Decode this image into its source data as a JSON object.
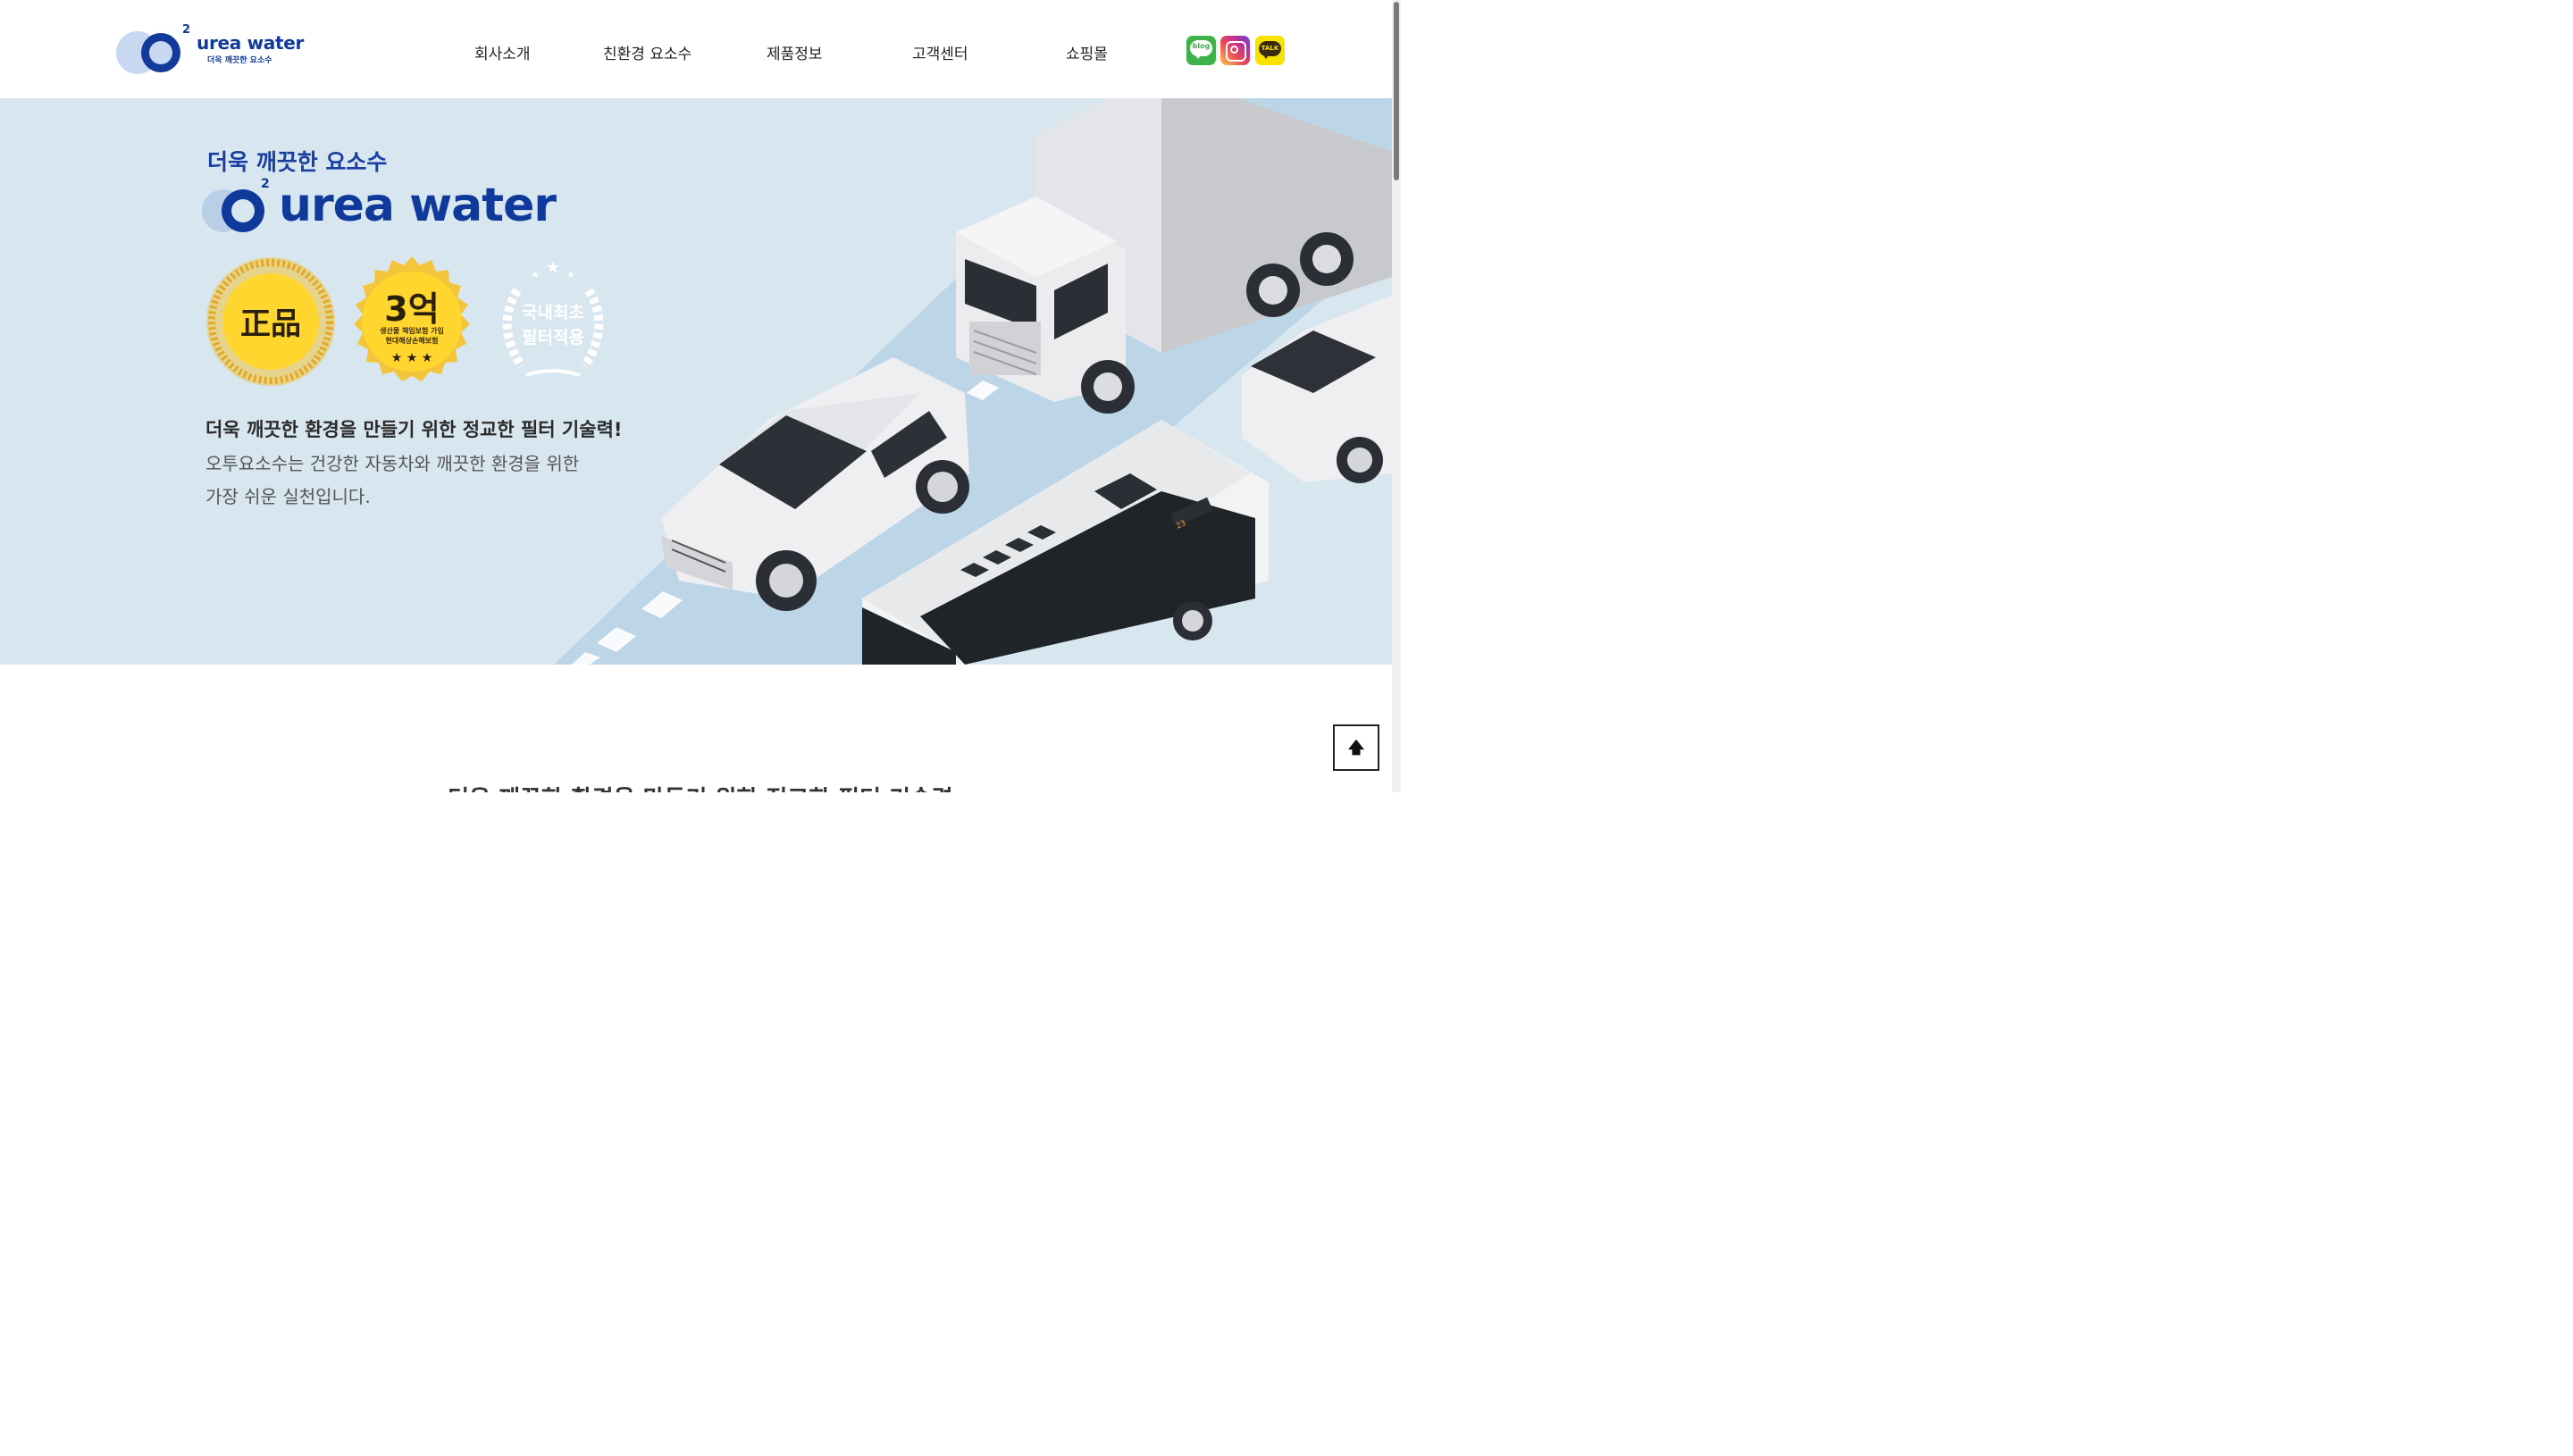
{
  "header": {
    "logo": {
      "sup": "2",
      "name": "urea water",
      "tagline": "더욱 깨끗한 요소수"
    },
    "nav": [
      {
        "label": "회사소개"
      },
      {
        "label": "친환경 요소수"
      },
      {
        "label": "제품정보"
      },
      {
        "label": "고객센터"
      },
      {
        "label": "쇼핑몰"
      }
    ],
    "social": [
      {
        "name": "blog",
        "label": "blog",
        "color": "#3fb24a"
      },
      {
        "name": "instagram",
        "label": "",
        "color": "#e9435b"
      },
      {
        "name": "kakaotalk",
        "label": "TALK",
        "color": "#f7e200"
      }
    ]
  },
  "hero": {
    "tagline": "더욱 깨끗한 요소수",
    "brand_sup": "2",
    "brand_name": "urea water",
    "badges": [
      {
        "main": "正品",
        "sub": ""
      },
      {
        "main": "3억",
        "sub": "생산물 책임보험 가입",
        "sub2": "현대해상손해보험"
      },
      {
        "main": "국내최초",
        "sub": "필터적용"
      }
    ],
    "headline": "더욱 깨끗한 환경을 만들기 위한 정교한 필터 기술력!",
    "body_line1": "오투요소수는 건강한 자동차와 깨끗한 환경을 위한",
    "body_line2": "가장 쉬운 실천입니다.",
    "bus_display": "23",
    "colors": {
      "background": "#d8e6f0",
      "road": "#bcd6e8",
      "brand_blue": "#0f3a9c"
    }
  },
  "section": {
    "title": "더욱 깨끗한 환경을 만들기 위한 정교한 필터 기술력"
  },
  "top_button": {
    "icon": "arrow-up-icon",
    "label": "🡅"
  }
}
